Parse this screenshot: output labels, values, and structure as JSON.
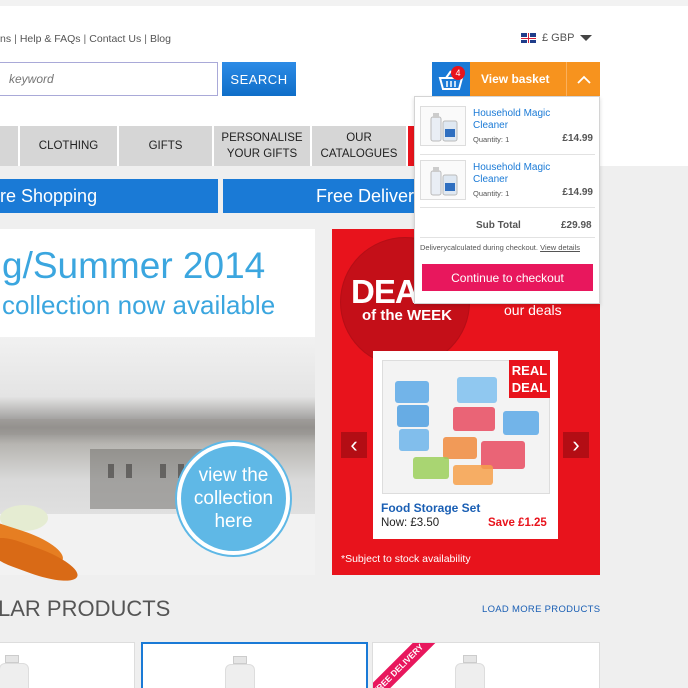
{
  "header": {
    "toplinks": [
      "ns",
      "Help & FAQs",
      "Contact Us",
      "Blog"
    ],
    "currency": "£ GBP",
    "search_placeholder": "keyword",
    "search_button": "SEARCH",
    "basket_count": "4",
    "view_basket_label": "View basket"
  },
  "nav": {
    "items": [
      "",
      "CLOTHING",
      "GIFTS",
      "PERSONALISE YOUR GIFTS",
      "OUR CATALOGUES"
    ]
  },
  "promo": {
    "left": "re Shopping",
    "right": "Free Delivery"
  },
  "hero": {
    "title": "g/Summer 2014",
    "subtitle": "collection now available",
    "cta": "view the collection here"
  },
  "deal": {
    "big": "DEA",
    "week": "of the WEEK",
    "our_deals": "our deals",
    "badge": "REAL DEAL",
    "product_name": "Food Storage Set",
    "now_price": "Now: £3.50",
    "save": "Save £1.25",
    "stock_note": "*Subject to stock availability",
    "prev_icon": "‹",
    "next_icon": "›"
  },
  "popular": {
    "title": "LAR PRODUCTS",
    "load_more": "LOAD MORE PRODUCTS",
    "free_delivery_badge": "FREE DELIVERY"
  },
  "basket_dropdown": {
    "items": [
      {
        "name": "Household Magic Cleaner",
        "qty": "Quantity: 1",
        "price": "£14.99"
      },
      {
        "name": "Household Magic Cleaner",
        "qty": "Quantity: 1",
        "price": "£14.99"
      }
    ],
    "subtotal_label": "Sub Total",
    "subtotal_value": "£29.98",
    "delivery_note": "Deliverycalculated during checkout.",
    "view_details": "View details",
    "checkout_button": "Continue to checkout"
  },
  "colors": {
    "brand_blue": "#1a7ad6",
    "basket_orange": "#f7931e",
    "deal_red": "#e8131c",
    "checkout_pink": "#e8175d",
    "hero_blue": "#3ba6df"
  }
}
